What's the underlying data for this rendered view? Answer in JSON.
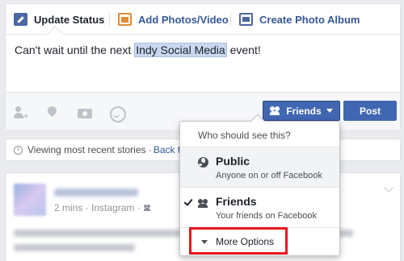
{
  "composer": {
    "tabs": [
      {
        "label": "Update Status"
      },
      {
        "label": "Add Photos/Video"
      },
      {
        "label": "Create Photo Album"
      }
    ],
    "text_before": "Can't wait until the next ",
    "text_highlight": "Indy Social Media",
    "text_after": " event!",
    "icons": [
      "tag-people-icon",
      "location-icon",
      "camera-icon",
      "smiley-icon"
    ],
    "audience_button_label": "Friends",
    "post_button_label": "Post",
    "colors": {
      "primary": "#4267b2",
      "link": "#365899",
      "photo_accent": "#e08a3a"
    }
  },
  "viewing_bar": {
    "text": "Viewing most recent stories · ",
    "link": "Back t"
  },
  "story": {
    "meta": "2 mins · Instagram · "
  },
  "audience_dropdown": {
    "header": "Who should see this?",
    "options": [
      {
        "title": "Public",
        "subtitle": "Anyone on or off Facebook",
        "selected": false,
        "icon": "globe-icon"
      },
      {
        "title": "Friends",
        "subtitle": "Your friends on Facebook",
        "selected": true,
        "icon": "friends-icon"
      }
    ],
    "more_label": "More Options",
    "highlight_color": "#e8141c"
  }
}
